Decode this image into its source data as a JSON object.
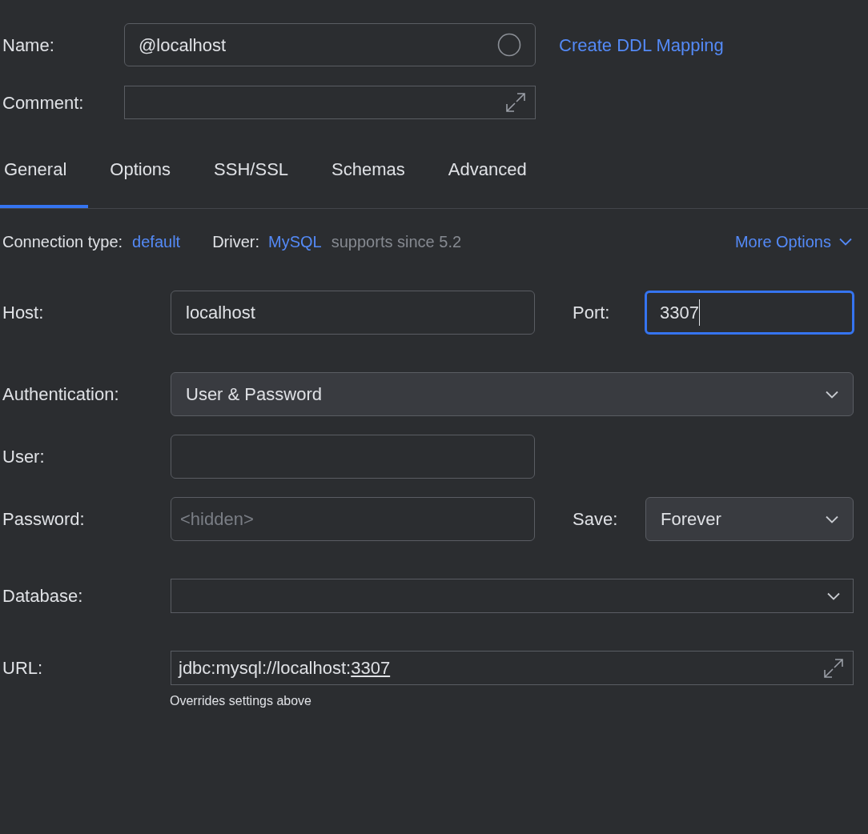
{
  "name_field": {
    "label": "Name:",
    "value": "@localhost"
  },
  "create_ddl_link": "Create DDL Mapping",
  "comment_field": {
    "label": "Comment:"
  },
  "tabs": [
    {
      "label": "General",
      "selected": true
    },
    {
      "label": "Options",
      "selected": false
    },
    {
      "label": "SSH/SSL",
      "selected": false
    },
    {
      "label": "Schemas",
      "selected": false
    },
    {
      "label": "Advanced",
      "selected": false
    }
  ],
  "connection_type": {
    "label": "Connection type:",
    "value": "default"
  },
  "driver": {
    "label": "Driver:",
    "value": "MySQL",
    "note": "supports since 5.2"
  },
  "more_options": "More Options",
  "host": {
    "label": "Host:",
    "value": "localhost"
  },
  "port": {
    "label": "Port:",
    "value": "3307",
    "focused": true
  },
  "authentication": {
    "label": "Authentication:",
    "value": "User & Password"
  },
  "user": {
    "label": "User:"
  },
  "password": {
    "label": "Password:",
    "placeholder": "<hidden>"
  },
  "save": {
    "label": "Save:",
    "value": "Forever"
  },
  "database": {
    "label": "Database:"
  },
  "url": {
    "label": "URL:",
    "value": "jdbc:mysql://localhost:",
    "port": "3307",
    "hint": "Overrides settings above"
  }
}
